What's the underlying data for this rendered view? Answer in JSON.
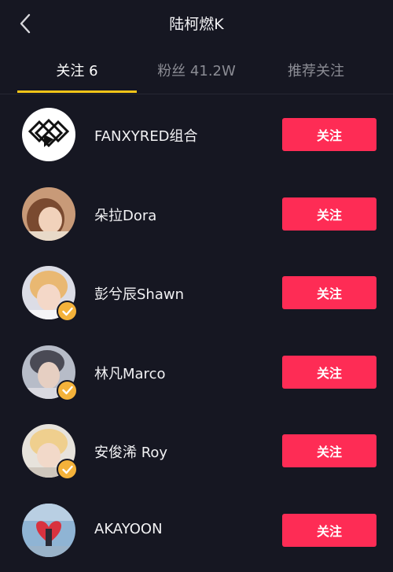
{
  "header": {
    "title": "陆柯燃K",
    "back_icon": "chevron-left-icon"
  },
  "tabs": [
    {
      "label": "关注 6",
      "active": true
    },
    {
      "label": "粉丝 41.2W",
      "active": false
    },
    {
      "label": "推荐关注",
      "active": false
    }
  ],
  "colors": {
    "background": "#161722",
    "accent_underline": "#f5c518",
    "follow_button": "#fe2c55",
    "verified_badge": "#f4b23a"
  },
  "users": [
    {
      "name": "FANXYRED组合",
      "verified": false,
      "button_label": "关注"
    },
    {
      "name": "朵拉Dora",
      "verified": false,
      "button_label": "关注"
    },
    {
      "name": "彭兮辰Shawn",
      "verified": true,
      "button_label": "关注"
    },
    {
      "name": "林凡Marco",
      "verified": true,
      "button_label": "关注"
    },
    {
      "name": "安俊浠 Roy",
      "verified": true,
      "button_label": "关注"
    },
    {
      "name": "AKAYOON",
      "verified": false,
      "button_label": "关注"
    }
  ]
}
